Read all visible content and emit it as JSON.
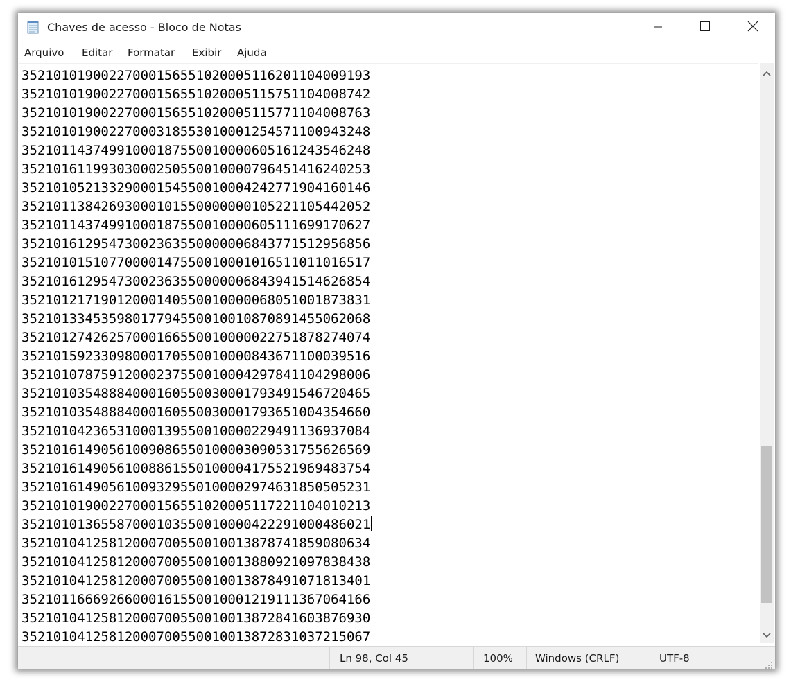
{
  "window": {
    "title": "Chaves de acesso - Bloco de Notas",
    "icons": {
      "app": "notepad-icon",
      "minimize": "minimize-icon",
      "maximize": "maximize-icon",
      "close": "close-icon"
    }
  },
  "menu": [
    "Arquivo",
    "Editar",
    "Formatar",
    "Exibir",
    "Ajuda"
  ],
  "editor": {
    "lines": [
      "35210101900227000156551020005116201104009193",
      "35210101900227000156551020005115751104008742",
      "35210101900227000156551020005115771104008763",
      "35210101900227000318553010001254571100943248",
      "35210114374991000187550010000605161243546248",
      "35210161199303000250550010000796451416240253",
      "35210105213329000154550010004242771904160146",
      "35210113842693000101550000000105221105442052",
      "35210114374991000187550010000605111699170627",
      "35210161295473002363550000006843771512956856",
      "35210101510770000147550010001016511011016517",
      "35210161295473002363550000006843941514626854",
      "35210121719012000140550010000068051001873831",
      "35210133453598017794550010010870891455062068",
      "35210127426257000166550010000022751878274074",
      "35210159233098000170550010000843671100039516",
      "35210107875912000237550010004297841104298006",
      "35210103548884000160550030001793491546720465",
      "35210103548884000160550030001793651004354660",
      "35210104236531000139550010000229491136937084",
      "35210161490561009086550100003090531755626569",
      "35210161490561008861550100004175521969483754",
      "35210161490561009329550100002974631850505231",
      "35210101900227000156551020005117221104010213",
      "35210101365587000103550010000422291000486021",
      "35210104125812000700550010013878741859080634",
      "35210104125812000700550010013880921097838438",
      "35210104125812000700550010013878491071813401",
      "35210116669266000161550010001219111367064166",
      "35210104125812000700550010013872841603876930",
      "35210104125812000700550010013872831037215067"
    ],
    "caret_line_index": 24
  },
  "scrollbar": {
    "up_icon": "chevron-up-icon",
    "down_icon": "chevron-down-icon",
    "position_fraction": 0.73
  },
  "status": {
    "position": "Ln 98, Col 45",
    "zoom": "100%",
    "line_ending": "Windows (CRLF)",
    "encoding": "UTF-8"
  },
  "colors": {
    "chrome": "#f0f0f0",
    "text": "#000000",
    "thumb": "#c2c2c2"
  }
}
